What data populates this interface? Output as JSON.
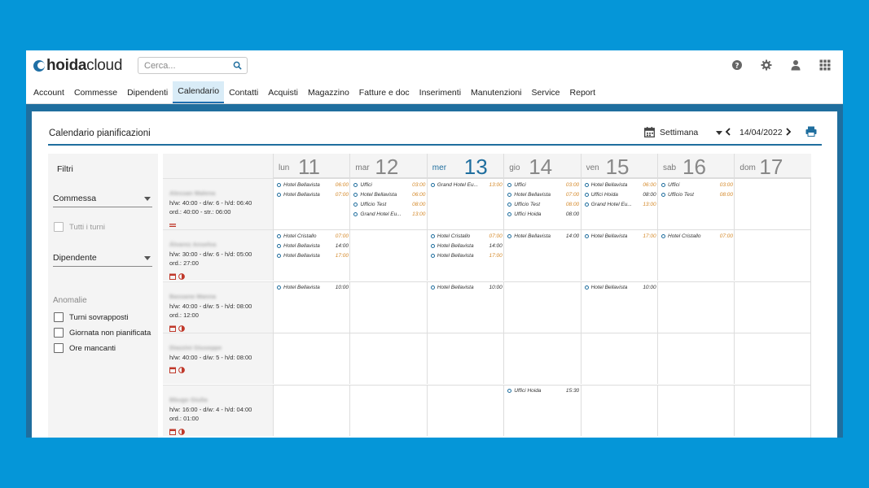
{
  "app": {
    "logo_prefix": "hoida",
    "logo_suffix": "cloud"
  },
  "search": {
    "placeholder": "Cerca..."
  },
  "top_icons": [
    "help-icon",
    "gear-icon",
    "user-icon",
    "apps-grid-icon"
  ],
  "nav": {
    "items": [
      "Account",
      "Commesse",
      "Dipendenti",
      "Calendario",
      "Contatti",
      "Acquisti",
      "Magazzino",
      "Fatture e doc",
      "Inserimenti",
      "Manutenzioni",
      "Service",
      "Report"
    ],
    "active": "Calendario"
  },
  "panel": {
    "title": "Calendario pianificazioni",
    "view": "Settimana",
    "date": "14/04/2022"
  },
  "filters": {
    "title": "Filtri",
    "commessa_label": "Commessa",
    "tutti_turni": "Tutti i turni",
    "dipendente_label": "Dipendente",
    "anomalie_label": "Anomalie",
    "anomalies": [
      "Turni sovrapposti",
      "Giornata non pianificata",
      "Ore mancanti"
    ]
  },
  "days": [
    {
      "name": "lun",
      "num": "11"
    },
    {
      "name": "mar",
      "num": "12"
    },
    {
      "name": "mer",
      "num": "13",
      "today": true
    },
    {
      "name": "gio",
      "num": "14"
    },
    {
      "name": "ven",
      "num": "15"
    },
    {
      "name": "sab",
      "num": "16"
    },
    {
      "name": "dom",
      "num": "17"
    }
  ],
  "employees": [
    {
      "name": "Alessan Malena",
      "line1": "h/w: 40:00 - d/w: 6 - h/d: 06:40",
      "line2": "ord.: 40:00 - str.: 06:00",
      "icons": [
        "dash-icon"
      ]
    },
    {
      "name": "Álvarez Anselva",
      "line1": "h/w: 30:00 - d/w: 6 - h/d: 05:00",
      "line2": "ord.: 27:00",
      "icons": [
        "calendar-icon",
        "clock-icon"
      ]
    },
    {
      "name": "Bassano Manna",
      "line1": "h/w: 40:00 - d/w: 5 - h/d: 08:00",
      "line2": "ord.: 12:00",
      "icons": [
        "calendar-icon",
        "clock-icon"
      ]
    },
    {
      "name": "Diazzini Giuseppe",
      "line1": "h/w: 40:00 - d/w: 5 - h/d: 08:00",
      "line2": "",
      "icons": [
        "calendar-icon",
        "clock-icon"
      ]
    },
    {
      "name": "Bbugo Giulia",
      "line1": "h/w: 16:00 - d/w: 4 - h/d: 04:00",
      "line2": "ord.: 01:00",
      "icons": [
        "calendar-icon",
        "clock-icon"
      ]
    }
  ],
  "shifts": [
    [
      [
        {
          "n": "Hotel Bellavista",
          "t": "06:00",
          "c": "orange"
        },
        {
          "n": "Hotel Bellavista",
          "t": "07:00",
          "c": "orange"
        }
      ],
      [
        {
          "n": "Uffici",
          "t": "03:00",
          "c": "orange"
        },
        {
          "n": "Hotel Bellavista",
          "t": "06:00",
          "c": "orange"
        },
        {
          "n": "Ufficio Test",
          "t": "08:00",
          "c": "orange"
        },
        {
          "n": "Grand Hotel Eu...",
          "t": "13:00",
          "c": "orange"
        }
      ],
      [
        {
          "n": "Grand Hotel Eu...",
          "t": "13:00",
          "c": "orange"
        }
      ],
      [
        {
          "n": "Uffici",
          "t": "03:00",
          "c": "orange"
        },
        {
          "n": "Hotel Bellavista",
          "t": "07:00",
          "c": "orange"
        },
        {
          "n": "Ufficio Test",
          "t": "08:00",
          "c": "orange"
        },
        {
          "n": "Uffici Hoida",
          "t": "08:00",
          "c": "black"
        }
      ],
      [
        {
          "n": "Hotel Bellavista",
          "t": "06:00",
          "c": "orange"
        },
        {
          "n": "Uffici Hoida",
          "t": "08:00",
          "c": "black"
        },
        {
          "n": "Grand Hotel Eu...",
          "t": "13:00",
          "c": "orange"
        }
      ],
      [
        {
          "n": "Uffici",
          "t": "03:00",
          "c": "orange"
        },
        {
          "n": "Ufficio Test",
          "t": "08:00",
          "c": "orange"
        }
      ],
      []
    ],
    [
      [
        {
          "n": "Hotel Cristallo",
          "t": "07:00",
          "c": "orange"
        },
        {
          "n": "Hotel Bellavista",
          "t": "14:00",
          "c": "black"
        },
        {
          "n": "Hotel Bellavista",
          "t": "17:00",
          "c": "orange"
        }
      ],
      [],
      [
        {
          "n": "Hotel Cristallo",
          "t": "07:00",
          "c": "orange"
        },
        {
          "n": "Hotel Bellavista",
          "t": "14:00",
          "c": "black"
        },
        {
          "n": "Hotel Bellavista",
          "t": "17:00",
          "c": "orange"
        }
      ],
      [
        {
          "n": "Hotel Bellavista",
          "t": "14:00",
          "c": "black"
        }
      ],
      [
        {
          "n": "Hotel Bellavista",
          "t": "17:00",
          "c": "orange"
        }
      ],
      [
        {
          "n": "Hotel Cristallo",
          "t": "07:00",
          "c": "orange"
        }
      ],
      []
    ],
    [
      [
        {
          "n": "Hotel Bellavista",
          "t": "10:00",
          "c": "black"
        }
      ],
      [],
      [
        {
          "n": "Hotel Bellavista",
          "t": "10:00",
          "c": "black"
        }
      ],
      [],
      [
        {
          "n": "Hotel Bellavista",
          "t": "10:00",
          "c": "black"
        }
      ],
      [],
      []
    ],
    [
      [],
      [],
      [],
      [],
      [],
      [],
      []
    ],
    [
      [],
      [],
      [],
      [
        {
          "n": "Uffici Hoida",
          "t": "15:30",
          "c": "black"
        }
      ],
      [],
      [],
      []
    ]
  ],
  "colors": {
    "background": "#0596d8",
    "brand_dark": "#1f6e9e",
    "accent_orange": "#d4892a"
  }
}
